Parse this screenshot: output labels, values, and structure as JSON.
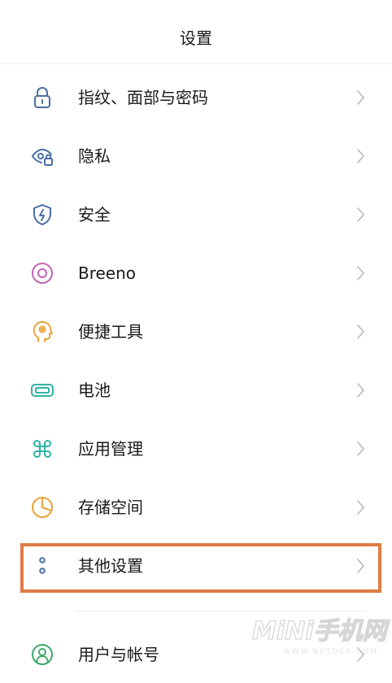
{
  "header": {
    "title": "设置"
  },
  "items": [
    {
      "label": "指纹、面部与密码",
      "icon": "lock-icon",
      "color": "#4A6FA5"
    },
    {
      "label": "隐私",
      "icon": "privacy-eye-lock-icon",
      "color": "#4A6FA5"
    },
    {
      "label": "安全",
      "icon": "shield-bolt-icon",
      "color": "#4A6FA5"
    },
    {
      "label": "Breeno",
      "icon": "breeno-ring-icon",
      "color": "#C065B5"
    },
    {
      "label": "便捷工具",
      "icon": "head-gear-icon",
      "color": "#E8A33A"
    },
    {
      "label": "电池",
      "icon": "battery-icon",
      "color": "#2FB3A5"
    },
    {
      "label": "应用管理",
      "icon": "app-grid-icon",
      "color": "#2FB3A5"
    },
    {
      "label": "存储空间",
      "icon": "storage-pie-icon",
      "color": "#E8A33A"
    },
    {
      "label": "其他设置",
      "icon": "more-dots-icon",
      "color": "#4A6FA5"
    },
    {
      "label": "用户与帐号",
      "icon": "user-account-icon",
      "color": "#3DAA6B"
    }
  ],
  "highlight_color": "#E07B45",
  "watermark": {
    "title": "MiNi手机网",
    "subtitle": "WWW.NETDEA.COM"
  }
}
